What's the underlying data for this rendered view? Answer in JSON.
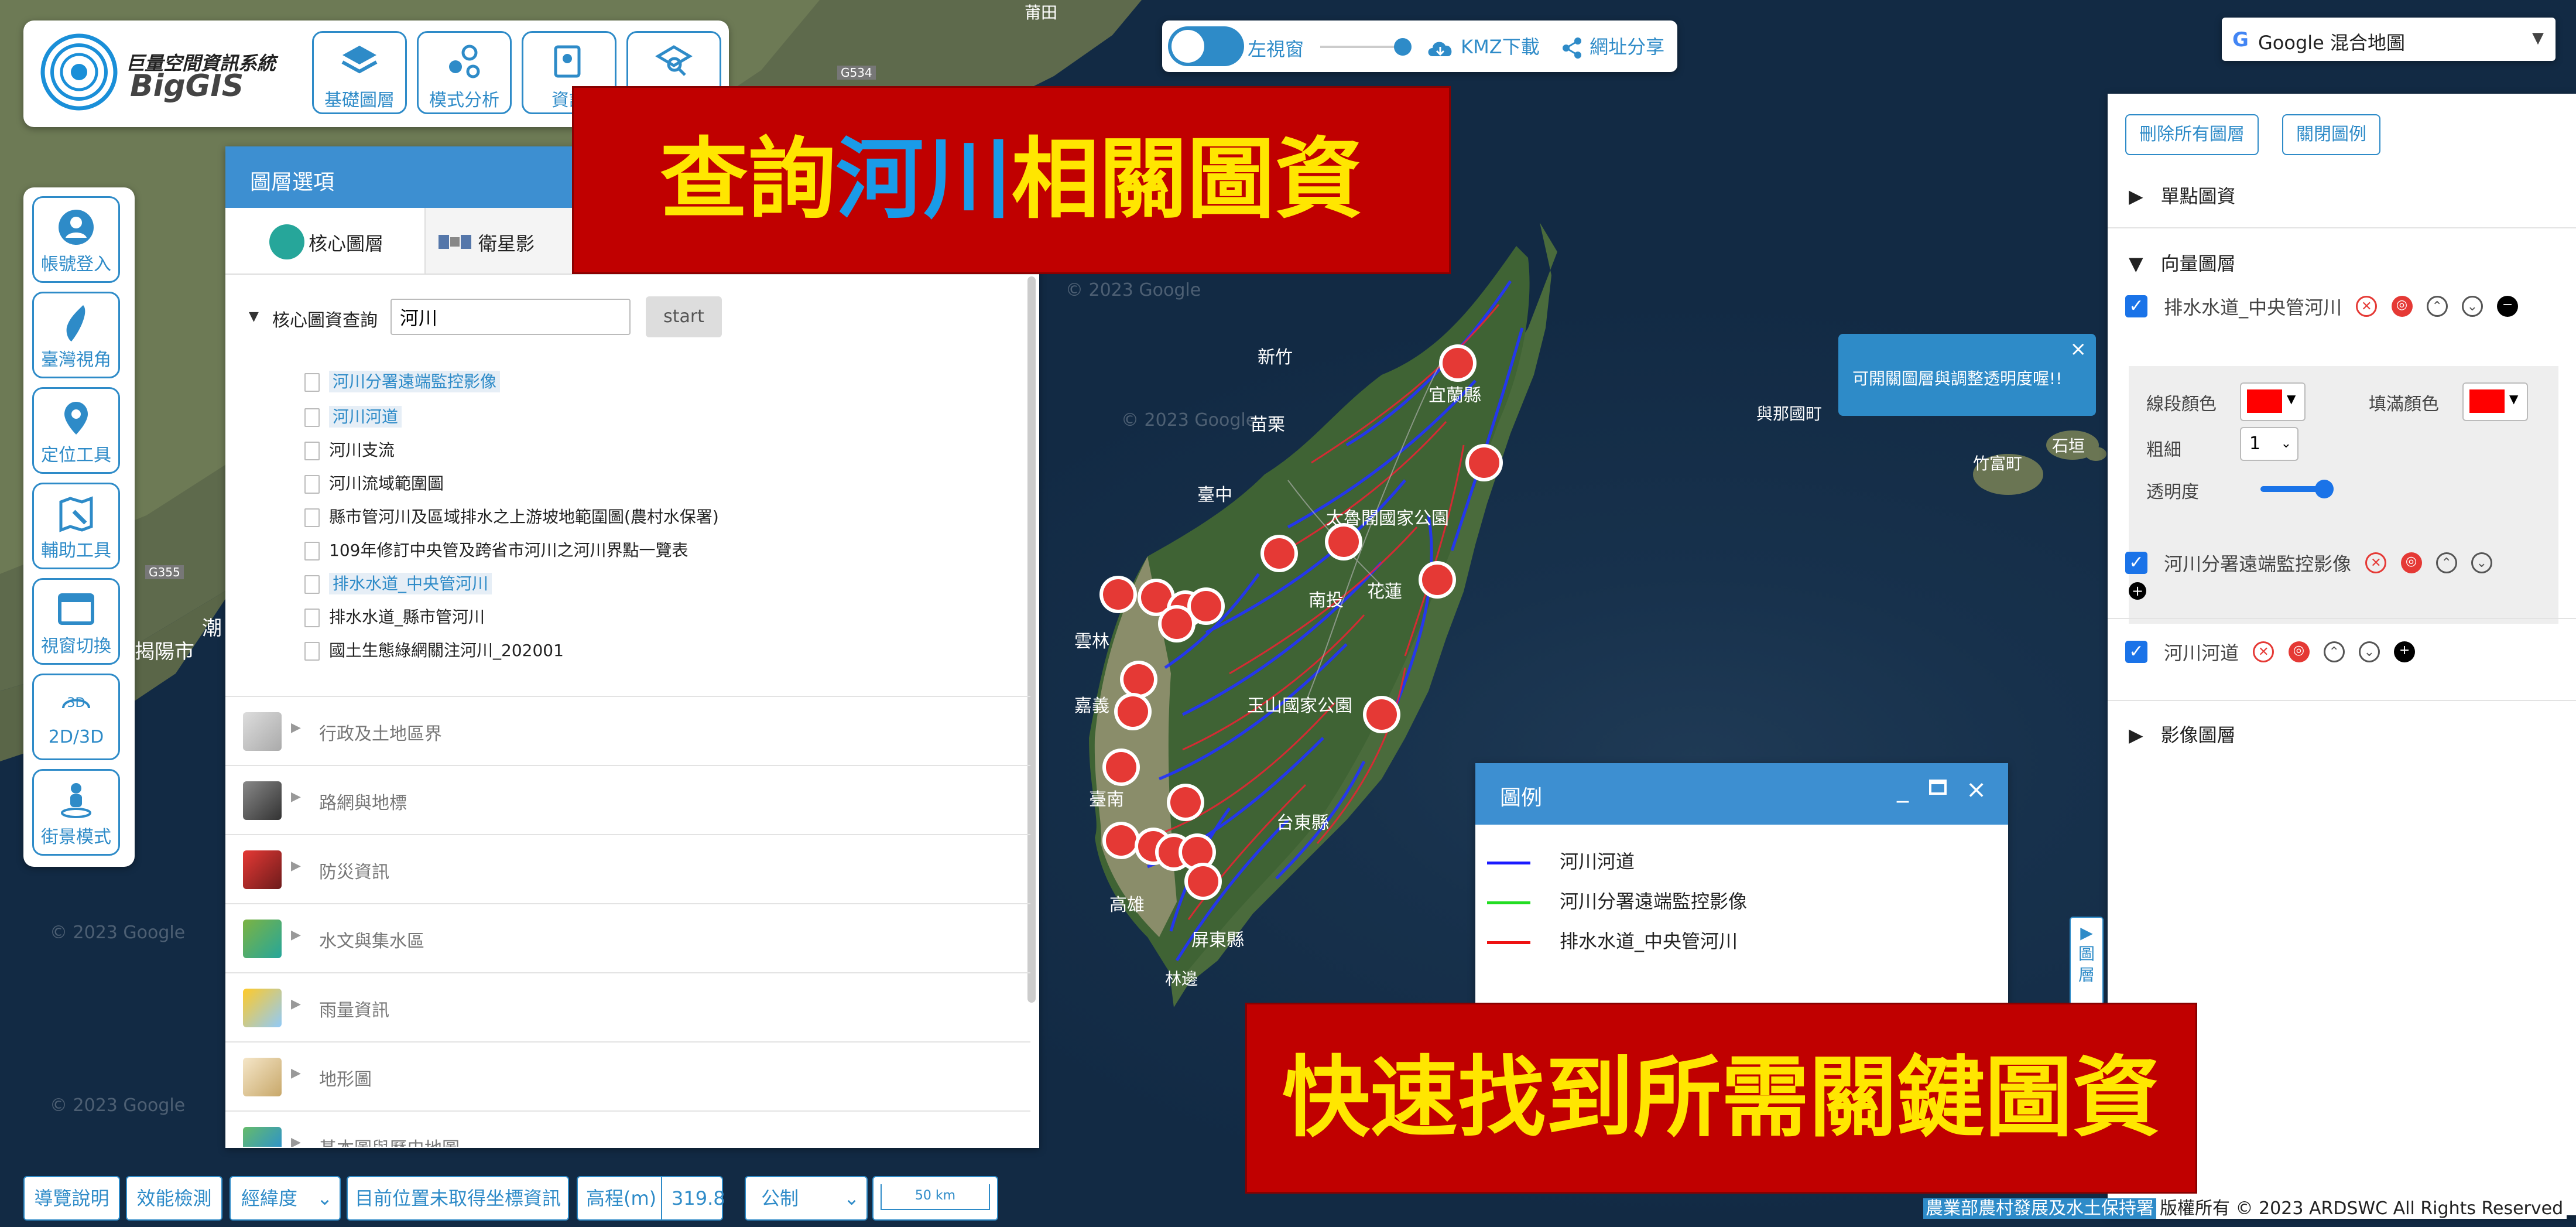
{
  "app": {
    "logo_title": "巨量空間資訊系統",
    "logo_name": "BigGIS"
  },
  "top_tools": [
    {
      "label": "基礎圖層",
      "icon": "layers-icon"
    },
    {
      "label": "模式分析",
      "icon": "nodes-icon"
    },
    {
      "label": "資訊",
      "icon": "map-pin-doc-icon"
    },
    {
      "label": "",
      "icon": "search-layers-icon"
    }
  ],
  "side_tools": [
    {
      "label": "帳號登入",
      "icon": "user-icon"
    },
    {
      "label": "臺灣視角",
      "icon": "taiwan-icon"
    },
    {
      "label": "定位工具",
      "icon": "location-pin-icon"
    },
    {
      "label": "輔助工具",
      "icon": "map-tool-icon"
    },
    {
      "label": "視窗切換",
      "icon": "window-icon"
    },
    {
      "label": "2D/3D",
      "icon": "3d-icon",
      "badge": "3D"
    },
    {
      "label": "街景模式",
      "icon": "street-view-icon"
    }
  ],
  "top_center": {
    "toggle_label": "左視窗",
    "kmz": "KMZ下載",
    "share": "網址分享"
  },
  "basemap_select": {
    "value": "Google 混合地圖"
  },
  "banners": {
    "top": {
      "part1": "查詢",
      "part2": "河川",
      "part3": "相關圖資",
      "highlight_color": "#1a9be8",
      "text_color": "#ffe600",
      "bg": "#c00000"
    },
    "bottom": {
      "text": "快速找到所需關鍵圖資"
    }
  },
  "layer_panel": {
    "title": "圖層選項",
    "tabs": [
      {
        "label": "核心圖層"
      },
      {
        "label": "衛星影"
      }
    ],
    "search_label": "核心圖資查詢",
    "search_value": "河川",
    "search_button": "start",
    "results": [
      {
        "label": "河川分署遠端監控影像",
        "highlighted": true
      },
      {
        "label": "河川河道",
        "highlighted": true
      },
      {
        "label": "河川支流",
        "highlighted": false
      },
      {
        "label": "河川流域範圍圖",
        "highlighted": false
      },
      {
        "label": "縣市管河川及區域排水之上游坡地範圍圖(農村水保署)",
        "highlighted": false
      },
      {
        "label": "109年修訂中央管及跨省市河川之河川界點一覽表",
        "highlighted": false
      },
      {
        "label": "排水水道_中央管河川",
        "highlighted": true
      },
      {
        "label": "排水水道_縣市管河川",
        "highlighted": false
      },
      {
        "label": "國土生態綠網關注河川_202001",
        "highlighted": false
      }
    ],
    "categories": [
      {
        "label": "行政及土地區界"
      },
      {
        "label": "路網與地標"
      },
      {
        "label": "防災資訊"
      },
      {
        "label": "水文與集水區"
      },
      {
        "label": "雨量資訊"
      },
      {
        "label": "地形圖"
      },
      {
        "label": "基本圖與歷史地圖"
      }
    ]
  },
  "right_panel": {
    "buttons": [
      "刪除所有圖層",
      "關閉圖例"
    ],
    "group_point": "單點圖資",
    "group_vector": "向量圖層",
    "group_image": "影像圖層",
    "layers": [
      {
        "name": "排水水道_中央管河川",
        "checked": true
      },
      {
        "name": "河川分署遠端監控影像",
        "checked": true
      },
      {
        "name": "河川河道",
        "checked": true
      }
    ],
    "style": {
      "line_color_label": "線段顏色",
      "fill_color_label": "填滿顏色",
      "line_color": "#ff0000",
      "fill_color": "#ff0000",
      "width_label": "粗細",
      "width_value": "1",
      "opacity_label": "透明度"
    }
  },
  "tooltip": {
    "text": "可開關圖層與調整透明度喔!!"
  },
  "legend": {
    "title": "圖例",
    "items": [
      {
        "label": "河川河道",
        "color": "#1a1aff"
      },
      {
        "label": "河川分署遠端監控影像",
        "color": "#22dd22"
      },
      {
        "label": "排水水道_中央管河川",
        "color": "#ee1111"
      }
    ],
    "collapse_tab": "圖層"
  },
  "status_bar": {
    "guide": "導覽說明",
    "perf": "效能檢測",
    "coord_system": "經緯度",
    "coord_text": "目前位置未取得坐標資訊",
    "elev_label": "高程(m)",
    "elev_value": "319.8",
    "unit": "公制",
    "scale": "50 km"
  },
  "map_labels": {
    "hsinchu": "新竹",
    "miaoli": "苗栗",
    "yilan": "宜蘭縣",
    "taichung": "臺中",
    "nantou": "南投",
    "hualien": "花蓮",
    "yushan": "玉山國家公園",
    "taitung": "台東縣",
    "tainan": "臺南",
    "kaohsiung": "高雄",
    "pingtung": "屏東縣",
    "yunlin": "雲林",
    "chiayi": "嘉義",
    "jieyang": "揭陽市",
    "chaozhou": "潮",
    "yonaguni": "與那國町",
    "taketomi": "竹富町",
    "ishigaki": "石垣",
    "putian": "莆田",
    "watermark1": "© 2023 Google",
    "watermark2": "© 2023 Google",
    "watermark3": "© 2023 Google",
    "watermark4": "© 2023 Google",
    "road1": "G534",
    "road2": "G355",
    "taroko": "太魯閣國家公園",
    "hengchun": "林邊",
    "shijiu": "玉"
  },
  "footer": {
    "agency": "農業部農村發展及水土保持署",
    "copyright": "版權所有 © 2023 ARDSWC All Rights Reserved"
  }
}
